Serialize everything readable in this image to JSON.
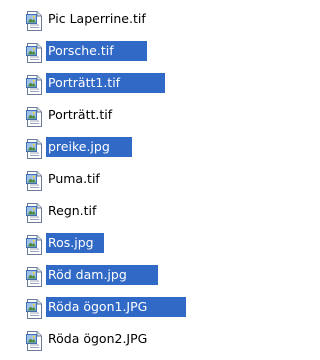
{
  "colors": {
    "selection_bg": "#3169C6",
    "selection_text": "#FFFFFF",
    "text": "#000000",
    "background": "#FFFFFF"
  },
  "files": [
    {
      "name": "Pic Laperrine.tif",
      "icon": "tif-image-file-icon",
      "selected": false
    },
    {
      "name": "Porsche.tif",
      "icon": "tif-image-file-icon",
      "selected": true
    },
    {
      "name": "Porträtt1.tif",
      "icon": "tif-image-file-icon",
      "selected": true
    },
    {
      "name": "Porträtt.tif",
      "icon": "tif-image-file-icon",
      "selected": false
    },
    {
      "name": "preike.jpg",
      "icon": "jpg-image-file-icon",
      "selected": true
    },
    {
      "name": "Puma.tif",
      "icon": "tif-image-file-icon",
      "selected": false
    },
    {
      "name": "Regn.tif",
      "icon": "tif-image-file-icon",
      "selected": false
    },
    {
      "name": "Ros.jpg",
      "icon": "jpg-image-file-icon",
      "selected": true
    },
    {
      "name": "Röd dam.jpg",
      "icon": "jpg-image-file-icon",
      "selected": true
    },
    {
      "name": "Röda ögon1.JPG",
      "icon": "jpg-image-file-icon",
      "selected": true
    },
    {
      "name": "Röda ögon2.JPG",
      "icon": "jpg-image-file-icon",
      "selected": false
    }
  ]
}
